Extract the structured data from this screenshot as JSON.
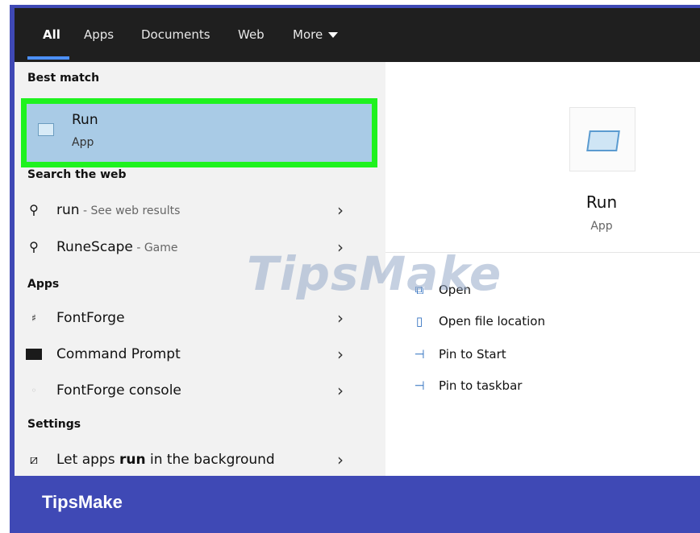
{
  "tabs": [
    {
      "label": "All",
      "active": true
    },
    {
      "label": "Apps"
    },
    {
      "label": "Documents"
    },
    {
      "label": "Web"
    },
    {
      "label": "More"
    }
  ],
  "sections": {
    "best_match": "Best match",
    "search_web": "Search the web",
    "apps": "Apps",
    "settings": "Settings"
  },
  "best_match": {
    "title": "Run",
    "subtitle": "App"
  },
  "web_results": [
    {
      "main": "run",
      "sub": " - See web results"
    },
    {
      "main": "RuneScape",
      "sub": " - Game"
    }
  ],
  "apps": [
    {
      "label": "FontForge",
      "icon": "fontforge-icon"
    },
    {
      "label": "Command Prompt",
      "icon": "command-prompt-icon"
    },
    {
      "label": "FontForge console",
      "icon": "fontforge-console-icon"
    }
  ],
  "settings_item": {
    "before": "Let apps ",
    "bold": "run",
    "after": " in the background"
  },
  "detail": {
    "name": "Run",
    "type": "App"
  },
  "actions": [
    {
      "label": "Open",
      "icon": "open-icon"
    },
    {
      "label": "Open file location",
      "icon": "folder-icon"
    },
    {
      "label": "Pin to Start",
      "icon": "pin-icon"
    },
    {
      "label": "Pin to taskbar",
      "icon": "pin-icon"
    }
  ],
  "watermark": "TipsMake",
  "footer_brand": "TipsMake",
  "colors": {
    "highlight": "#a9cbe6",
    "best_border": "#1ff21f",
    "frame": "#3f49b5",
    "tab_bar": "#1f1f1f"
  }
}
